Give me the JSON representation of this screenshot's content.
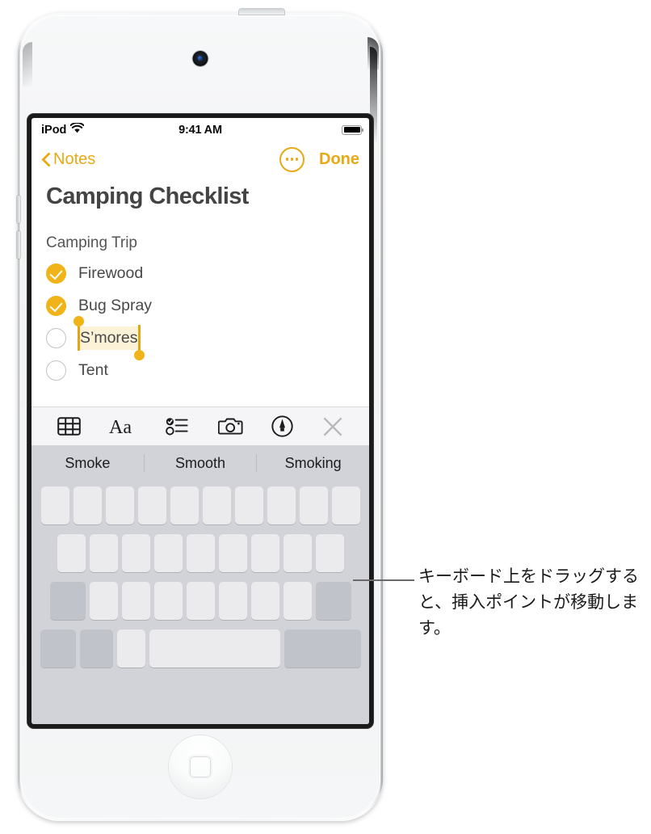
{
  "device": {
    "name": "iPod touch",
    "front_camera_icon": "front-camera",
    "home_button_icon": "home-button"
  },
  "status_bar": {
    "carrier": "iPod",
    "wifi_icon": "wifi-icon",
    "time": "9:41 AM",
    "battery_icon": "battery-full-icon"
  },
  "nav_bar": {
    "back_label": "Notes",
    "back_icon": "chevron-left-icon",
    "more_icon": "more-ellipsis-circle-icon",
    "done_label": "Done",
    "accent_color": "#e8aa14"
  },
  "note": {
    "title": "Camping Checklist",
    "section_label": "Camping Trip",
    "items": [
      {
        "label": "Firewood",
        "checked": true
      },
      {
        "label": "Bug Spray",
        "checked": true
      },
      {
        "label": "S’mores",
        "checked": false,
        "selected": true
      },
      {
        "label": "Tent",
        "checked": false,
        "partially_visible": true
      }
    ],
    "selection_handle_color": "#f0b418",
    "selection_highlight_color": "#fbf2d7"
  },
  "format_toolbar": {
    "items": [
      {
        "name": "table-icon",
        "label": "Table"
      },
      {
        "name": "text-format-icon",
        "label": "Aa"
      },
      {
        "name": "checklist-icon",
        "label": "Checklist"
      },
      {
        "name": "camera-icon",
        "label": "Camera"
      },
      {
        "name": "markup-pen-icon",
        "label": "Markup"
      },
      {
        "name": "close-icon",
        "label": "Close"
      }
    ]
  },
  "predictive_bar": {
    "suggestions": [
      "Smoke",
      "Smooth",
      "Smoking"
    ]
  },
  "keyboard": {
    "rows": [
      {
        "keys": 10,
        "style": "letter"
      },
      {
        "keys": 9,
        "style": "letter"
      },
      {
        "keys": 9,
        "style": "mixed"
      },
      {
        "keys": 5,
        "style": "bottom"
      }
    ]
  },
  "callout": {
    "text": "キーボード上をドラッグすると、挿入ポイントが移動します。"
  }
}
